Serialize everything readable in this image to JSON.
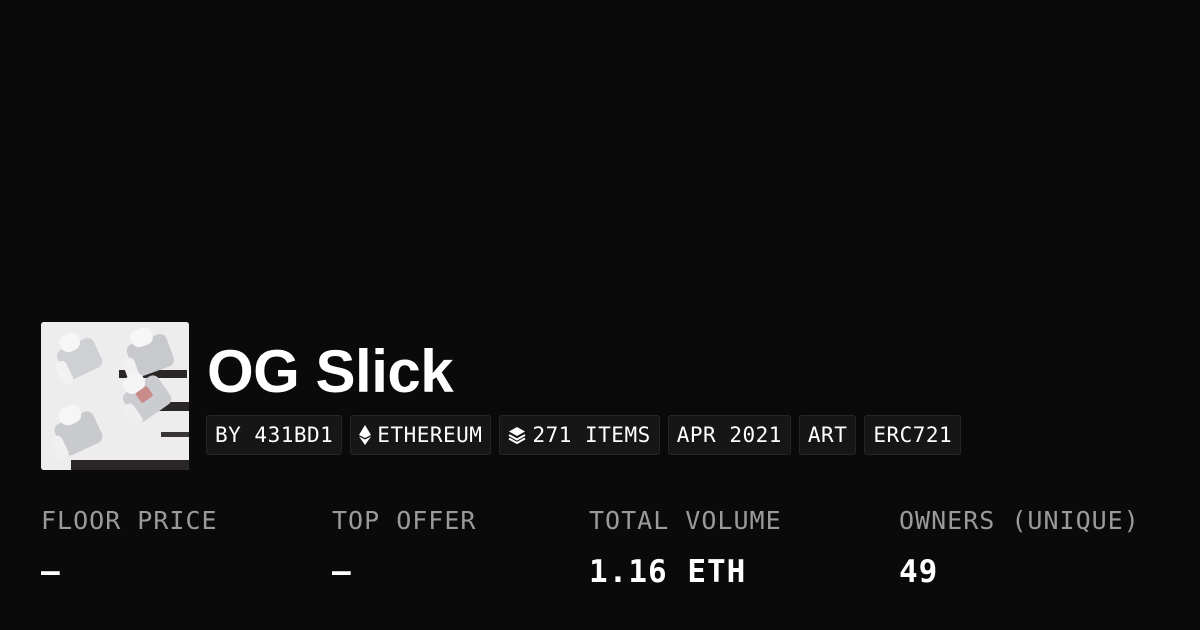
{
  "collection": {
    "name": "OG Slick",
    "image_alt": "OG Slick collection image"
  },
  "tags": [
    {
      "label": "BY 431BD1",
      "icon": null
    },
    {
      "label": "ETHEREUM",
      "icon": "ethereum-icon"
    },
    {
      "label": "271 ITEMS",
      "icon": "layers-icon"
    },
    {
      "label": "APR 2021",
      "icon": null
    },
    {
      "label": "ART",
      "icon": null
    },
    {
      "label": "ERC721",
      "icon": null
    }
  ],
  "stats": [
    {
      "label": "FLOOR PRICE",
      "value": "–"
    },
    {
      "label": "TOP OFFER",
      "value": "–"
    },
    {
      "label": "TOTAL VOLUME",
      "value": "1.16 ETH"
    },
    {
      "label": "OWNERS (UNIQUE)",
      "value": "49"
    }
  ],
  "colors": {
    "background": "#0a0a0a",
    "tag_background": "#161616",
    "label_gray": "#9a9a9a",
    "text": "#ffffff"
  }
}
